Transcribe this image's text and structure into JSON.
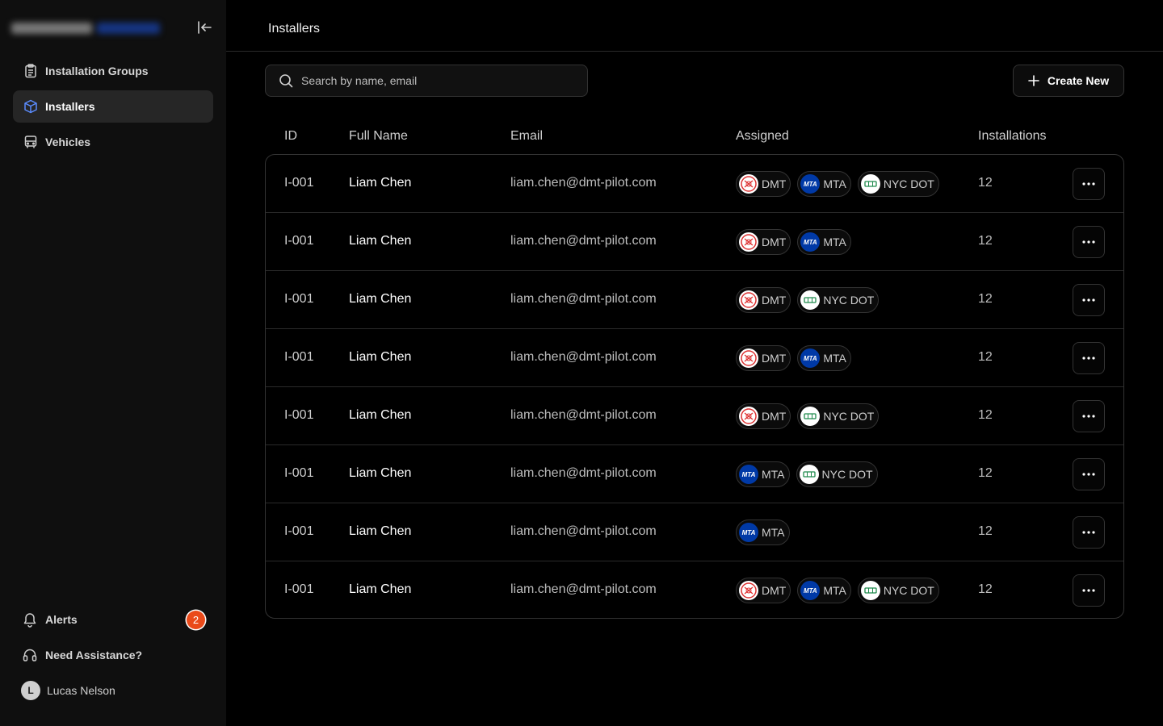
{
  "sidebar": {
    "nav": [
      {
        "label": "Installation Groups",
        "icon": "clipboard-icon"
      },
      {
        "label": "Installers",
        "icon": "cube-icon",
        "active": true
      },
      {
        "label": "Vehicles",
        "icon": "bus-icon"
      }
    ],
    "alerts": {
      "label": "Alerts",
      "count": "2"
    },
    "help": {
      "label": "Need Assistance?"
    },
    "user": {
      "initial": "L",
      "name": "Lucas Nelson"
    }
  },
  "header": {
    "title": "Installers"
  },
  "search": {
    "placeholder": "Search by name, email"
  },
  "create_button": {
    "label": "Create New"
  },
  "table": {
    "columns": [
      "ID",
      "Full Name",
      "Email",
      "Assigned",
      "Installations"
    ],
    "rows": [
      {
        "id": "I-001",
        "name": "Liam Chen",
        "email": "liam.chen@dmt-pilot.com",
        "assigned": [
          "DMT",
          "MTA",
          "NYC DOT"
        ],
        "installations": "12"
      },
      {
        "id": "I-001",
        "name": "Liam Chen",
        "email": "liam.chen@dmt-pilot.com",
        "assigned": [
          "DMT",
          "MTA"
        ],
        "installations": "12"
      },
      {
        "id": "I-001",
        "name": "Liam Chen",
        "email": "liam.chen@dmt-pilot.com",
        "assigned": [
          "DMT",
          "NYC DOT"
        ],
        "installations": "12"
      },
      {
        "id": "I-001",
        "name": "Liam Chen",
        "email": "liam.chen@dmt-pilot.com",
        "assigned": [
          "DMT",
          "MTA"
        ],
        "installations": "12"
      },
      {
        "id": "I-001",
        "name": "Liam Chen",
        "email": "liam.chen@dmt-pilot.com",
        "assigned": [
          "DMT",
          "NYC DOT"
        ],
        "installations": "12"
      },
      {
        "id": "I-001",
        "name": "Liam Chen",
        "email": "liam.chen@dmt-pilot.com",
        "assigned": [
          "MTA",
          "NYC DOT"
        ],
        "installations": "12"
      },
      {
        "id": "I-001",
        "name": "Liam Chen",
        "email": "liam.chen@dmt-pilot.com",
        "assigned": [
          "MTA"
        ],
        "installations": "12"
      },
      {
        "id": "I-001",
        "name": "Liam Chen",
        "email": "liam.chen@dmt-pilot.com",
        "assigned": [
          "DMT",
          "MTA",
          "NYC DOT"
        ],
        "installations": "12"
      }
    ]
  },
  "colors": {
    "background": "#000000",
    "sidebar": "#0f0f0f",
    "active_nav": "#262626",
    "alert_badge": "#ea4a1a",
    "mta_blue": "#0039a6"
  }
}
